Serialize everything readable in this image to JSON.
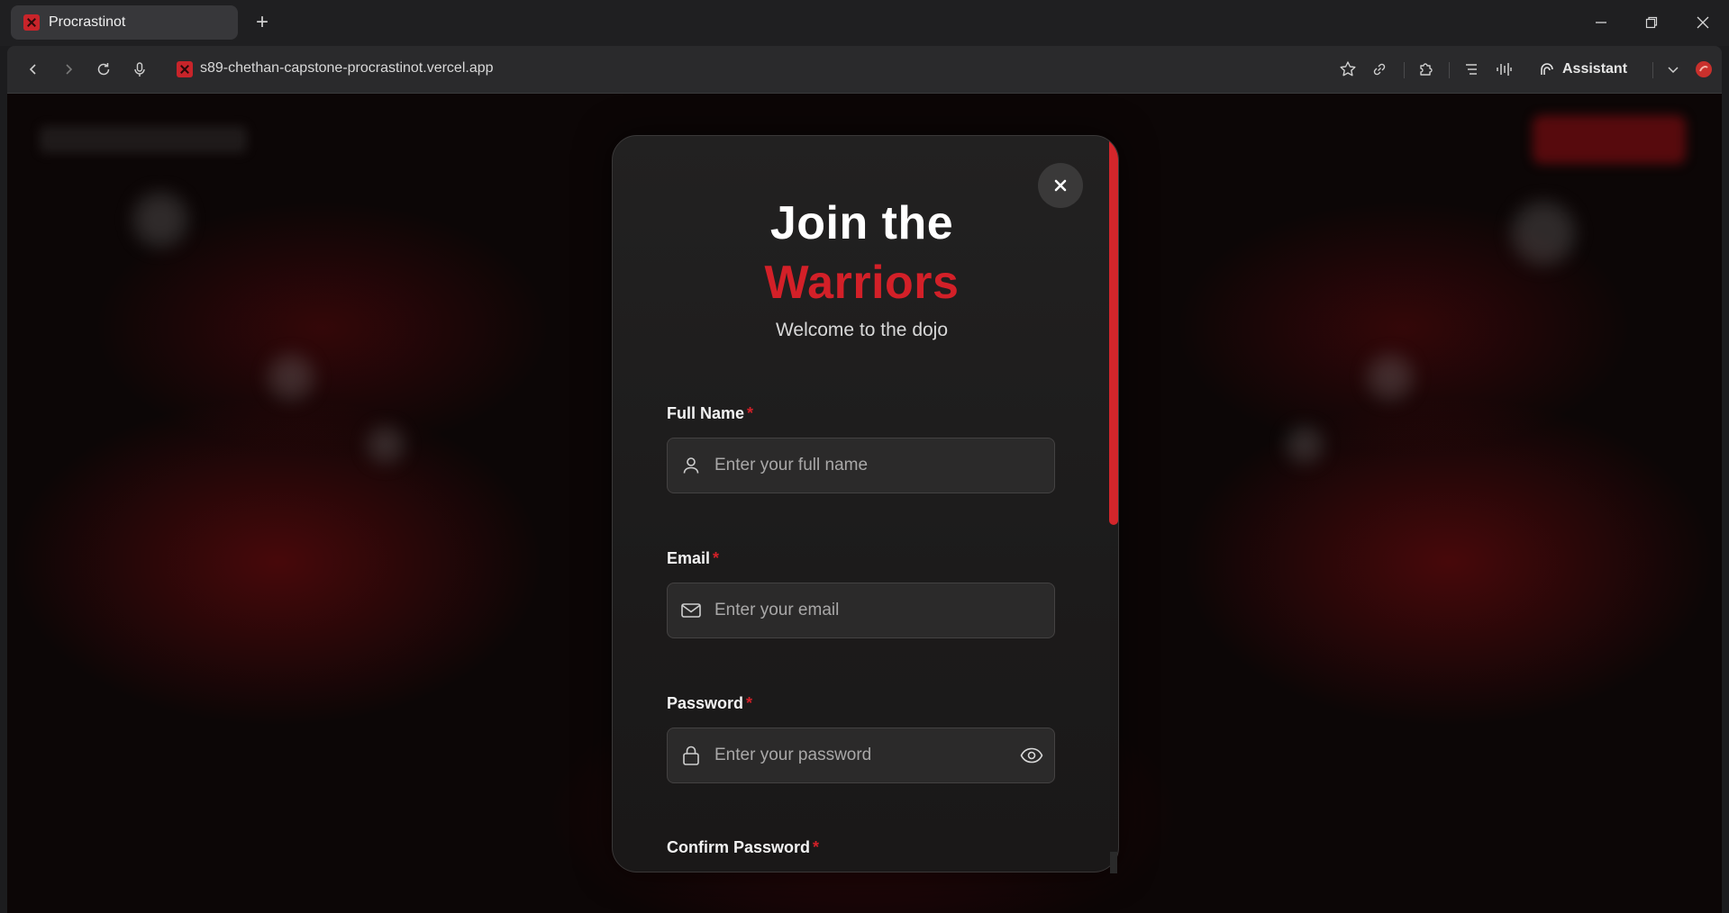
{
  "browser": {
    "tab_title": "Procrastinot",
    "new_tab_symbol": "+",
    "url": "s89-chethan-capstone-procrastinot.vercel.app",
    "assistant_label": "Assistant"
  },
  "modal": {
    "heading_line1": "Join the",
    "heading_line2": "Warriors",
    "subtitle": "Welcome to the dojo",
    "required_mark": "*",
    "fields": [
      {
        "label": "Full Name",
        "placeholder": "Enter your full name",
        "icon": "user-icon"
      },
      {
        "label": "Email",
        "placeholder": "Enter your email",
        "icon": "mail-icon"
      },
      {
        "label": "Password",
        "placeholder": "Enter your password",
        "icon": "lock-icon"
      },
      {
        "label": "Confirm Password"
      }
    ]
  },
  "colors": {
    "accent": "#d32028",
    "modal_bg": "#1f1e1e",
    "field_bg": "#2b2a2a",
    "chrome_bg": "#1f1f21"
  }
}
